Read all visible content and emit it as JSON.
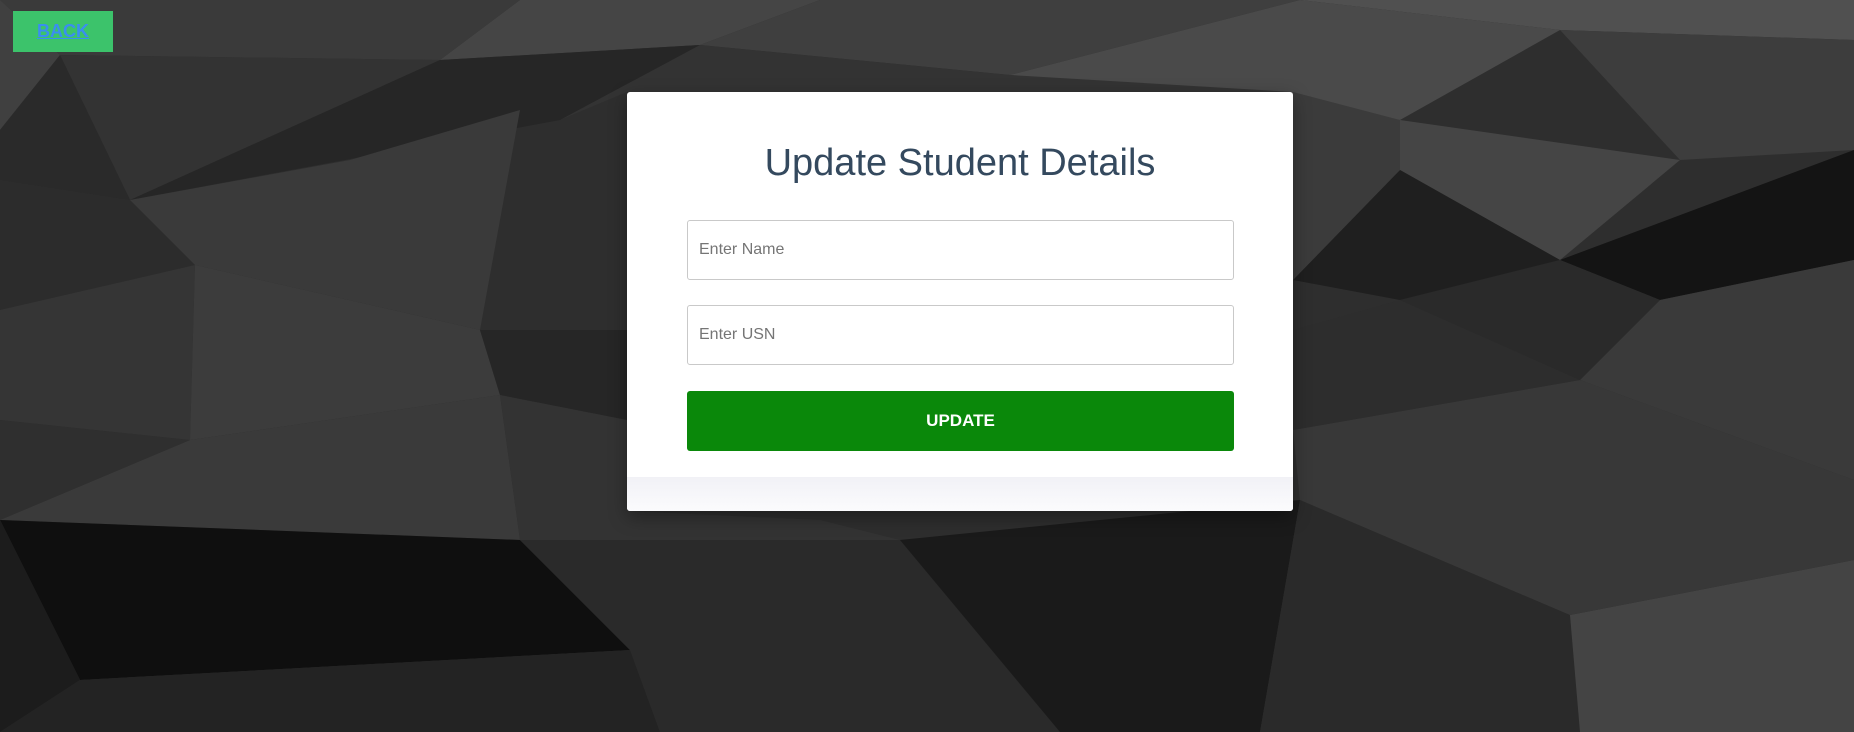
{
  "nav": {
    "back_label": "BACK"
  },
  "form": {
    "title": "Update Student Details",
    "name_placeholder": "Enter Name",
    "name_value": "",
    "usn_placeholder": "Enter USN",
    "usn_value": "",
    "submit_label": "UPDATE"
  },
  "colors": {
    "back_button_bg": "#3cc36b",
    "back_link": "#3a8ef0",
    "title_text": "#34495e",
    "submit_bg": "#0a880a",
    "card_bg": "#ffffff"
  },
  "background": {
    "style": "dark low-poly geometric pattern"
  }
}
